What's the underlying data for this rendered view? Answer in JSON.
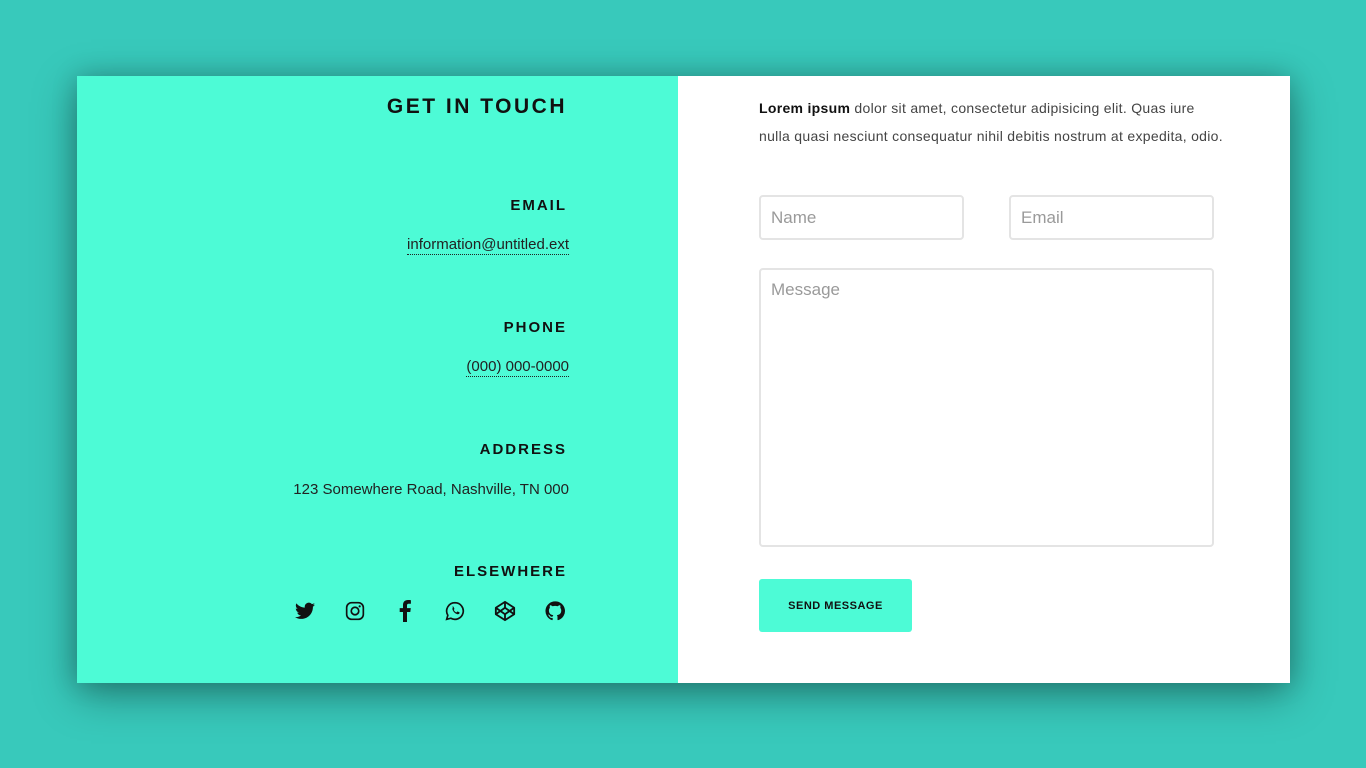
{
  "contact": {
    "title": "GET IN TOUCH",
    "email": {
      "label": "EMAIL",
      "value": "information@untitled.ext"
    },
    "phone": {
      "label": "PHONE",
      "value": "(000) 000-0000"
    },
    "address": {
      "label": "ADDRESS",
      "value": "123 Somewhere Road, Nashville, TN 000"
    },
    "elsewhere": {
      "label": "ELSEWHERE",
      "icons": [
        "twitter-icon",
        "instagram-icon",
        "facebook-icon",
        "whatsapp-icon",
        "codepen-icon",
        "github-icon"
      ]
    }
  },
  "form": {
    "intro_bold": "Lorem ipsum",
    "intro_rest": " dolor sit amet, consectetur adipisicing elit. Quas iure nulla quasi nesciunt consequatur nihil debitis nostrum at expedita, odio.",
    "name_placeholder": "Name",
    "email_placeholder": "Email",
    "message_placeholder": "Message",
    "send_label": "SEND MESSAGE"
  },
  "colors": {
    "background": "#38c9bb",
    "accent": "#4dfbd6",
    "panel": "#ffffff"
  }
}
